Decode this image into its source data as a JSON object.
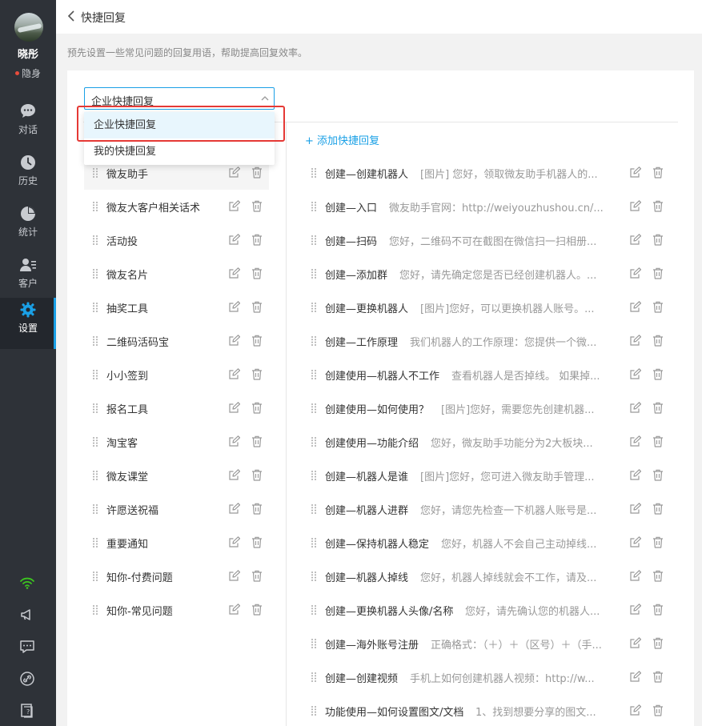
{
  "user": {
    "name": "晓彤",
    "status": "隐身"
  },
  "nav": [
    {
      "label": "对话",
      "icon": "chat-icon"
    },
    {
      "label": "历史",
      "icon": "clock-icon"
    },
    {
      "label": "统计",
      "icon": "pie-chart-icon"
    },
    {
      "label": "客户",
      "icon": "contacts-icon"
    },
    {
      "label": "设置",
      "icon": "gear-icon"
    }
  ],
  "bottom_icons": [
    "wifi-icon",
    "megaphone-icon",
    "feedback-icon",
    "link-icon",
    "help-icon"
  ],
  "colors": {
    "accent": "#1aa0e6",
    "sidebar": "#2e3238",
    "highlight": "#e53935",
    "online": "#3cc51f"
  },
  "header": {
    "title": "快捷回复"
  },
  "description": "预先设置一些常见问题的回复用语，帮助提高回复效率。",
  "select": {
    "value": "企业快捷回复",
    "options": [
      "企业快捷回复",
      "我的快捷回复"
    ]
  },
  "add_label": "+ 添加快捷回复",
  "categories": [
    "微友助手",
    "微友大客户相关话术",
    "活动投",
    "微友名片",
    "抽奖工具",
    "二维码活码宝",
    "小小签到",
    "报名工具",
    "淘宝客",
    "微友课堂",
    "许愿送祝福",
    "重要通知",
    "知你-付费问题",
    "知你-常见问题"
  ],
  "replies": [
    {
      "title": "创建—创建机器人",
      "preview": "[图片] 您好，领取微友助手机器人的..."
    },
    {
      "title": "创建—入口",
      "preview": "微友助手官网：http://weiyouzhushou.cn/..."
    },
    {
      "title": "创建—扫码",
      "preview": "您好，二维码不可在截图在微信扫一扫相册..."
    },
    {
      "title": "创建—添加群",
      "preview": "您好，请先确定您是否已经创建机器人。..."
    },
    {
      "title": "创建—更换机器人",
      "preview": "[图片]您好，可以更换机器人账号。..."
    },
    {
      "title": "创建—工作原理",
      "preview": "我们机器人的工作原理：您提供一个微..."
    },
    {
      "title": "创建使用—机器人不工作",
      "preview": "查看机器人是否掉线。 如果掉..."
    },
    {
      "title": "创建使用—如何使用？",
      "preview": "[图片]您好，需要您先创建机器..."
    },
    {
      "title": "创建使用—功能介绍",
      "preview": "您好，微友助手功能分为2大板块..."
    },
    {
      "title": "创建—机器人是谁",
      "preview": "[图片]您好，您可进入微友助手管理..."
    },
    {
      "title": "创建—机器人进群",
      "preview": "您好，请您先检查一下机器人账号是..."
    },
    {
      "title": "创建—保持机器人稳定",
      "preview": "您好，机器人不会自己主动掉线..."
    },
    {
      "title": "创建—机器人掉线",
      "preview": "您好，机器人掉线就会不工作，请及..."
    },
    {
      "title": "创建—更换机器人头像/名称",
      "preview": "您好，请先确认您的机器人..."
    },
    {
      "title": "创建—海外账号注册",
      "preview": "正确格式：（＋）＋（区号）＋（手..."
    },
    {
      "title": "创建—创建视频",
      "preview": "手机上如何创建机器人视频：http://w..."
    },
    {
      "title": "功能使用—如何设置图文/文档",
      "preview": "1、找到想要分享的图文..."
    }
  ]
}
